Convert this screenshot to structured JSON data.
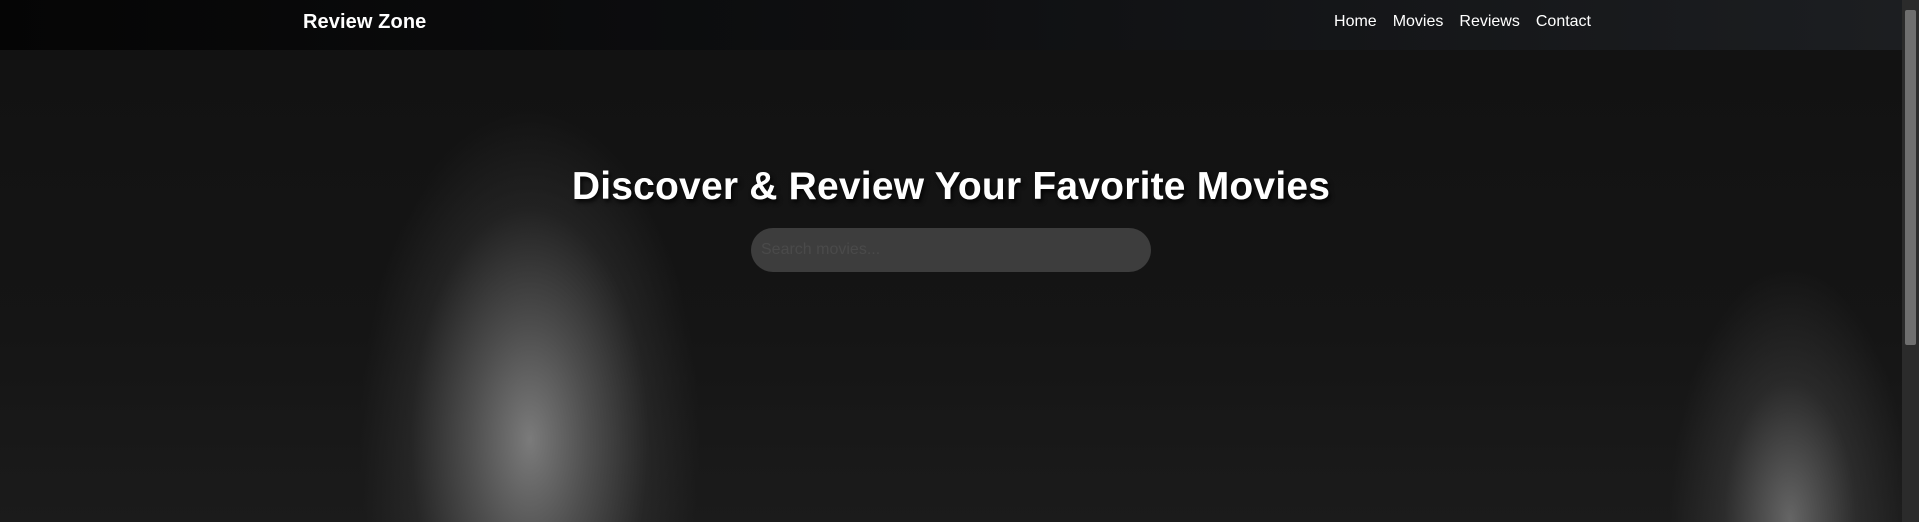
{
  "navbar": {
    "brand": "Review Zone",
    "links": [
      "Home",
      "Movies",
      "Reviews",
      "Contact"
    ]
  },
  "hero": {
    "title": "Discover & Review Your Favorite Movies",
    "search_placeholder": "Search movies..."
  },
  "colors": {
    "navbar_bg": "#0f1012",
    "hero_bg": "#121212",
    "text": "#ffffff"
  }
}
